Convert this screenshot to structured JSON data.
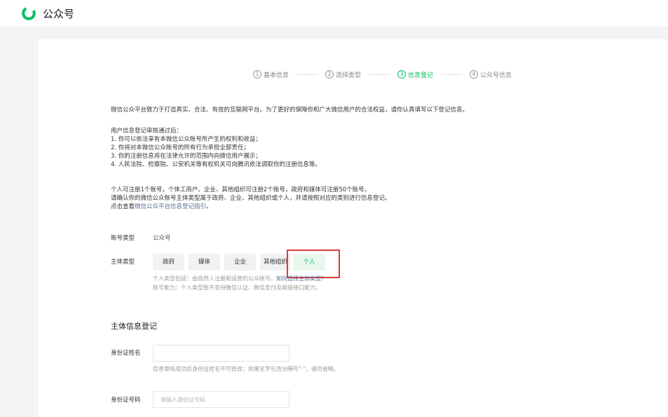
{
  "app": {
    "title": "公众号",
    "accent": "#07c160",
    "link_color": "#576b95"
  },
  "steps": [
    {
      "num": "1",
      "label": "基本信息",
      "active": false
    },
    {
      "num": "2",
      "label": "选择类型",
      "active": false
    },
    {
      "num": "3",
      "label": "信息登记",
      "active": true
    },
    {
      "num": "4",
      "label": "公众号信息",
      "active": false
    }
  ],
  "intro": {
    "main": "微信公众平台致力于打造真实、合法、有效的互联网平台。为了更好的保障你和广大微信用户的合法权益，请你认真填写以下登记信息。",
    "review_title": "用户信息登记审核通过后：",
    "review_items": [
      "1. 你可以依法享有本微信公众账号所产生的权利和收益；",
      "2. 你将对本微信公众账号的所有行为承担全部责任；",
      "3. 你的注册信息将在法律允许的范围内向微信用户展示；",
      "4. 人民法院、检察院、公安机关等有权机关可向腾讯依法调取你的注册信息等。"
    ],
    "limits": "个人可注册1个账号，个体工商户、企业、其他组织可注册2个账号，政府和媒体可注册50个账号。",
    "confirm": "请确认你的微信公众账号主体类型属于政府、企业、其他组织或个人，并请按照对应的类别进行信息登记。",
    "guide_prefix": "点击查看",
    "guide_link": "微信公众平台信息登记指引",
    "guide_suffix": "。"
  },
  "account_type": {
    "label": "账号类型",
    "value": "公众号"
  },
  "subject_type": {
    "label": "主体类型",
    "options": [
      "政府",
      "媒体",
      "企业",
      "其他组织",
      "个人"
    ],
    "selected": "个人",
    "hint1_text": "个人类型包括：由自然人注册和运营的公众账号。",
    "hint1_link": "如何选择主体类型?",
    "hint2": "账号能力：个人类型暂不支持微信认证、微信支付及高级接口能力。"
  },
  "registration": {
    "section_title": "主体信息登记",
    "id_name": {
      "label": "身份证姓名",
      "value": "",
      "placeholder": "",
      "hint": "信息审核成功后身份证姓名不可修改；如果名字包含分隔号\"·\"，请勿省略。"
    },
    "id_number": {
      "label": "身份证号码",
      "value": "",
      "placeholder": "请输入身份证号码"
    }
  }
}
